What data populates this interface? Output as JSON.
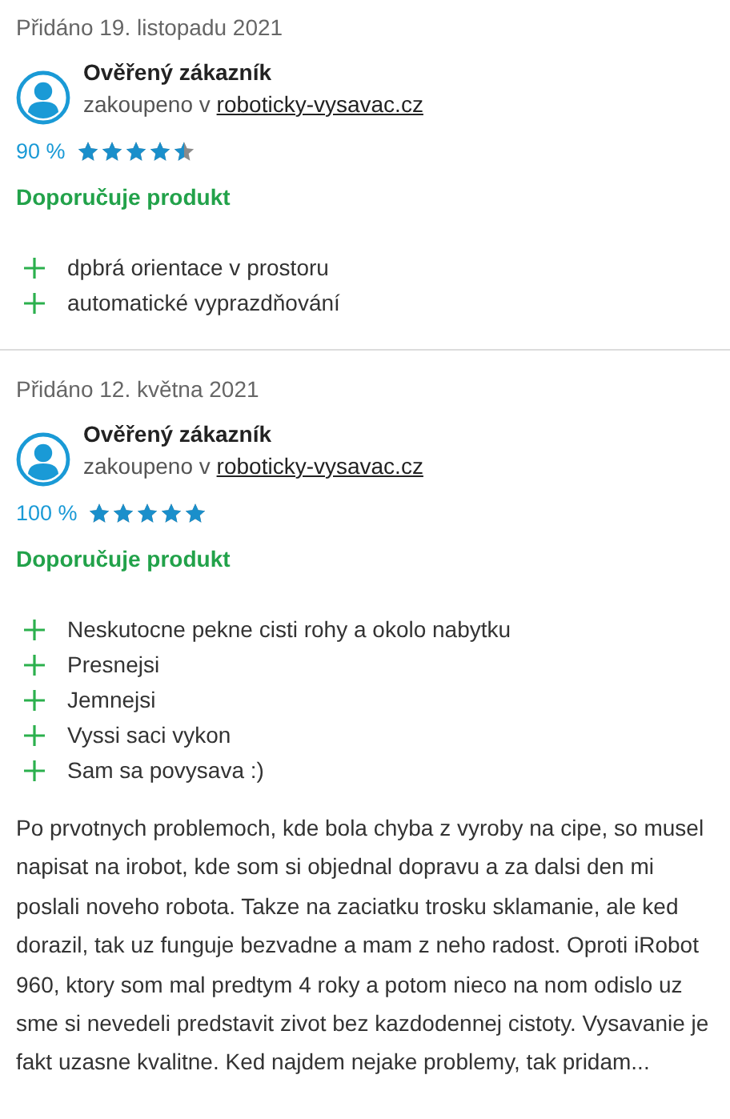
{
  "reviews": [
    {
      "date": "Přidáno 19. listopadu 2021",
      "author": "Ověřený zákazník",
      "purchased": "zakoupeno v",
      "shop": "roboticky-vysavac.cz",
      "percent": "90 %",
      "stars": 4.5,
      "recommend": "Doporučuje produkt",
      "pros": [
        "dpbrá orientace v prostoru",
        "automatické vyprazdňování"
      ]
    },
    {
      "date": "Přidáno 12. května 2021",
      "author": "Ověřený zákazník",
      "purchased": "zakoupeno v",
      "shop": "roboticky-vysavac.cz",
      "percent": "100 %",
      "stars": 5,
      "recommend": "Doporučuje produkt",
      "pros": [
        "Neskutocne pekne cisti rohy a okolo nabytku",
        "Presnejsi",
        "Jemnejsi",
        "Vyssi saci vykon",
        "Sam sa povysava :)"
      ],
      "text": "Po prvotnych problemoch, kde bola chyba z vyroby na cipe, so musel napisat na irobot, kde som si objednal dopravu a za dalsi den mi poslali noveho robota. Takze na zaciatku trosku sklamanie, ale ked dorazil, tak uz funguje bezvadne a mam z neho radost. Oproti iRobot 960, ktory som mal predtym 4 roky a potom nieco na nom odislo uz sme si nevedeli predstavit zivot bez kazdodennej cistoty. Vysavanie je fakt uzasne kvalitne. Ked najdem nejake problemy, tak pridam..."
    }
  ]
}
